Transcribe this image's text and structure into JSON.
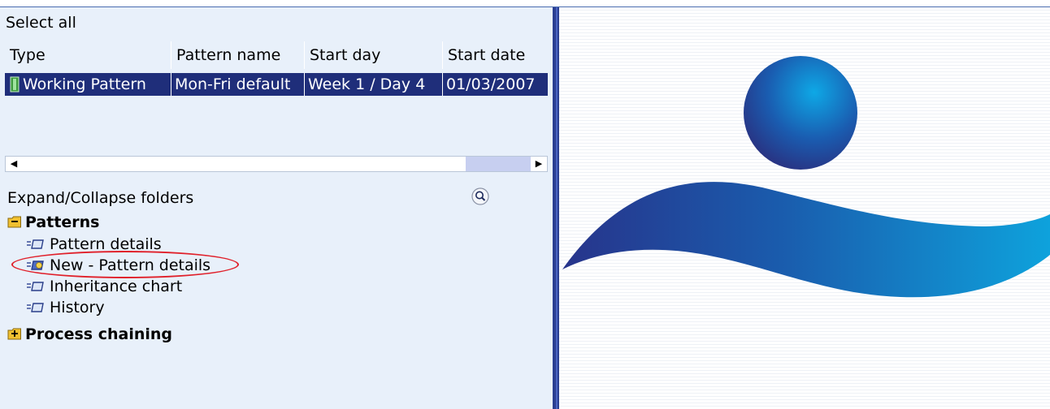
{
  "toolbar": {
    "select_all": "Select all"
  },
  "grid": {
    "columns": [
      "Type",
      "Pattern name",
      "Start day",
      "Start date"
    ],
    "rows": [
      {
        "type": "Working Pattern",
        "pattern_name": "Mon-Fri default",
        "start_day": "Week 1 / Day 4",
        "start_date": "01/03/2007"
      }
    ]
  },
  "scrollbar": {
    "left_arrow": "◀",
    "right_arrow": "▶"
  },
  "expand": {
    "label": "Expand/Collapse folders"
  },
  "tree": {
    "folders": [
      {
        "label": "Patterns",
        "state": "expanded",
        "items": [
          "Pattern details",
          "New - Pattern details",
          "Inheritance chart",
          "History"
        ]
      },
      {
        "label": "Process chaining",
        "state": "collapsed",
        "items": []
      }
    ]
  },
  "colors": {
    "selected_row": "#1f2e7a",
    "highlight_ellipse": "#e0202a",
    "divider": "#2b3f92",
    "panel_bg": "#e8f0fa"
  }
}
